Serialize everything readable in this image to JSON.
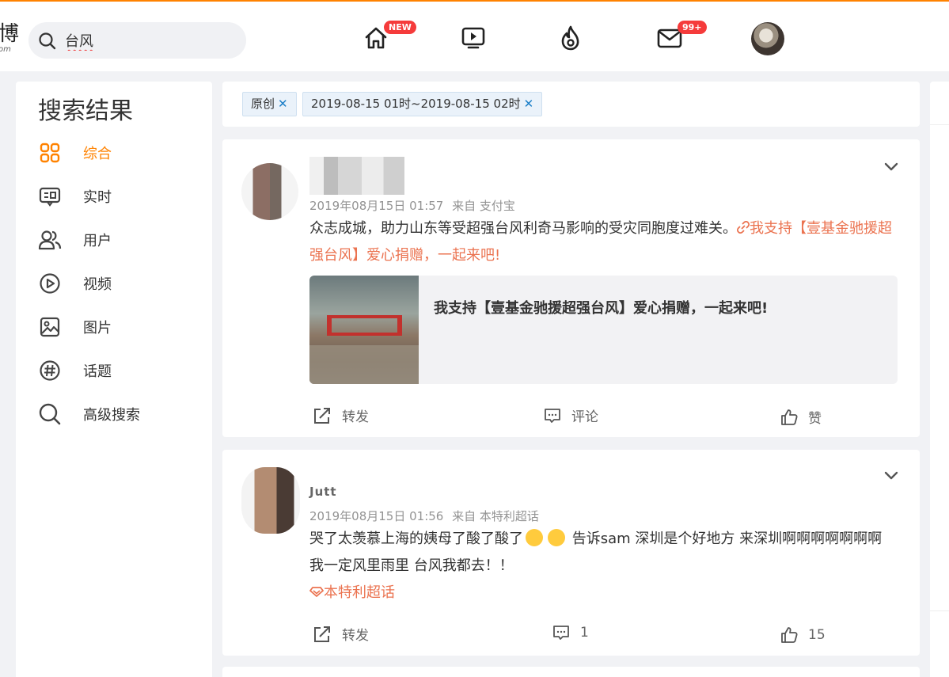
{
  "search": {
    "query": "台风"
  },
  "nav": {
    "home_badge": "NEW",
    "messages_badge": "99+"
  },
  "left": {
    "title": "搜索结果",
    "items": [
      {
        "label": "综合",
        "icon": "grid-icon",
        "active": true
      },
      {
        "label": "实时",
        "icon": "realtime-icon"
      },
      {
        "label": "用户",
        "icon": "users-icon"
      },
      {
        "label": "视频",
        "icon": "video-icon"
      },
      {
        "label": "图片",
        "icon": "image-icon"
      },
      {
        "label": "话题",
        "icon": "topic-icon"
      },
      {
        "label": "高级搜索",
        "icon": "search-icon"
      }
    ]
  },
  "filters": [
    {
      "label": "原创"
    },
    {
      "label": "2019-08-15 01时~2019-08-15 02时"
    }
  ],
  "posts": [
    {
      "meta_time": "2019年08月15日 01:57",
      "meta_source": "来自 支付宝",
      "text": "众志成城，助力山东等受超强台风利奇马影响的受灾同胞度过难关。",
      "link_text": "我支持【壹基金驰援超强台风】爱心捐赠，一起来吧!",
      "card_title": "我支持【壹基金驰援超强台风】爱心捐赠，一起来吧!",
      "repost": "转发",
      "comment": "评论",
      "like": "赞"
    },
    {
      "name": "Jutt",
      "meta_time": "2019年08月15日 01:56",
      "meta_source": "来自 本特利超话",
      "text_a": "哭了太羡慕上海的姨母了酸了酸了",
      "text_b": " 告诉sam 深圳是个好地方 来深圳啊啊啊啊啊啊啊 我一定风里雨里 台风我都去！！",
      "topic": "本特利超话",
      "repost": "转发",
      "comment": "1",
      "like": "15"
    }
  ],
  "colors": {
    "accent": "#ff8200",
    "link": "#eb7350",
    "badge": "#f53b3b"
  }
}
